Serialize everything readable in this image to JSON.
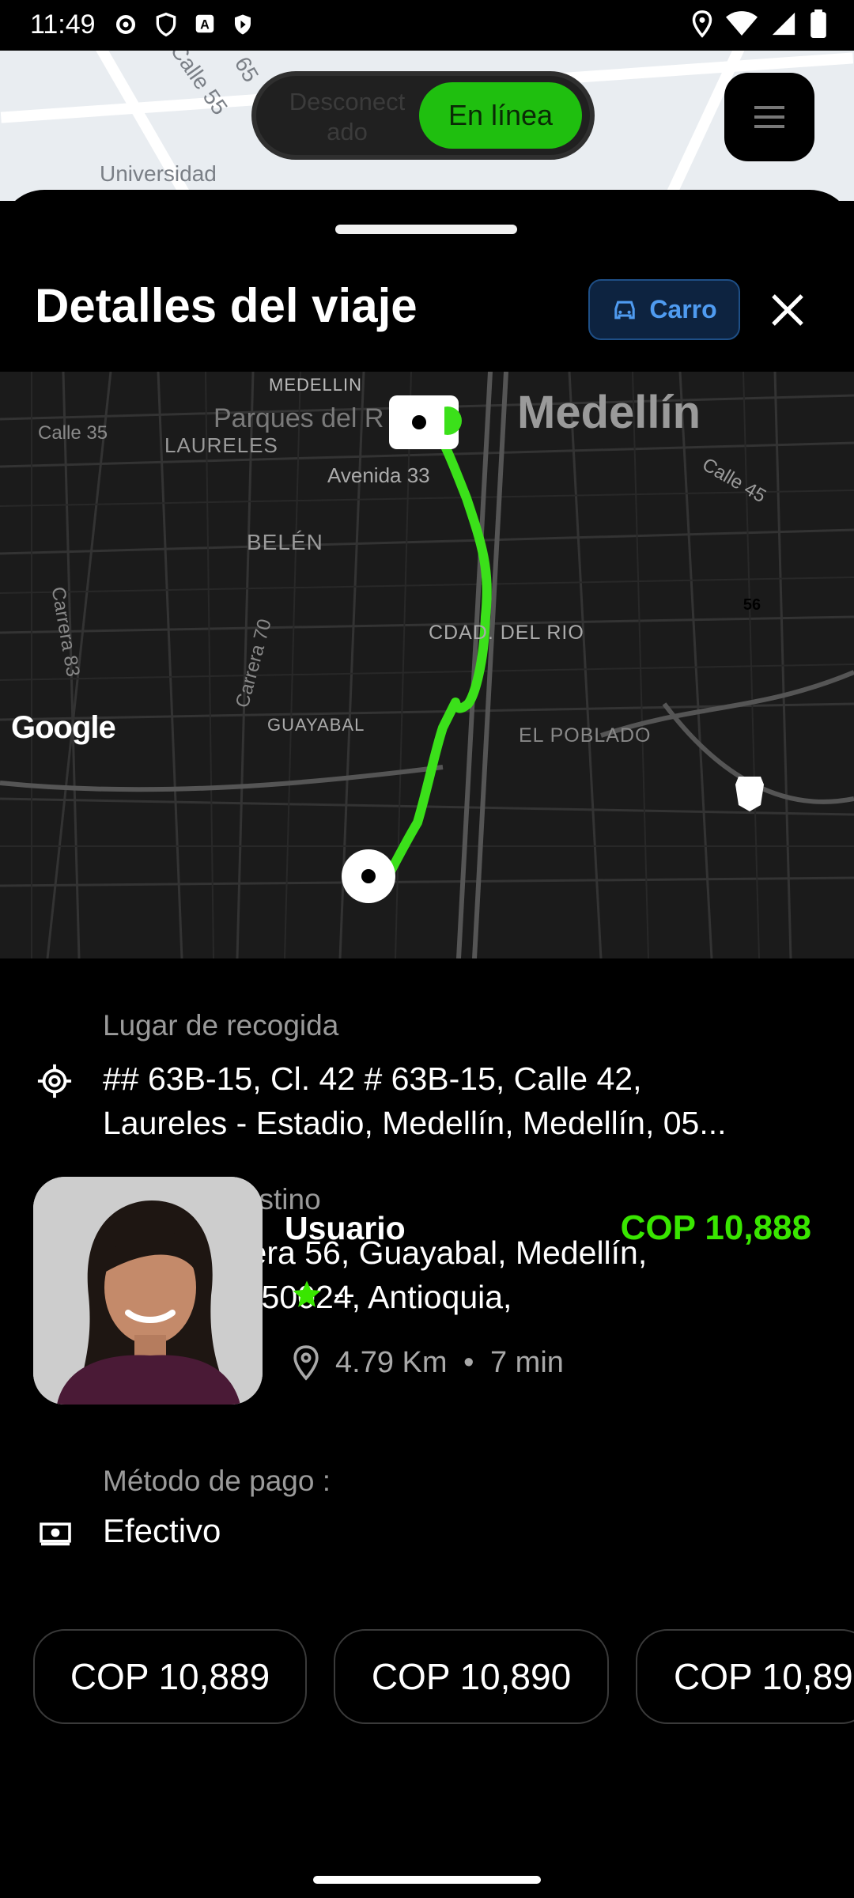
{
  "status_bar": {
    "time": "11:49"
  },
  "top_map": {
    "street_label_1": "Calle 55",
    "street_label_2": "Universidad",
    "street_label_3": "65"
  },
  "toggle": {
    "offline_label": "Desconectado",
    "online_label": "En línea"
  },
  "sheet": {
    "title": "Detalles del viaje",
    "vehicle_badge": "Carro",
    "vehicle_icon": "car-icon"
  },
  "map": {
    "labels": {
      "medellin_small": "MEDELLIN",
      "medellin_big": "Medellín",
      "parques": "Parques del R",
      "laureles": "LAURELES",
      "calle35": "Calle 35",
      "avenida33": "Avenida 33",
      "calle45": "Calle 45",
      "belen": "BELÉN",
      "carrera83": "Carrera 83",
      "carrera70": "Carrera 70",
      "cdad_rio": "CDAD. DEL RIO",
      "guayabal": "GUAYABAL",
      "poblado": "EL POBLADO",
      "route56": "56"
    },
    "attribution": "Google",
    "route_color": "#3be01a"
  },
  "pickup": {
    "label": "Lugar de recogida",
    "address_line1": "## 63B-15, Cl. 42 # 63B-15, Calle 42,",
    "address_line2": "Laureles - Estadio, Medellín, Medellín, 05..."
  },
  "destination": {
    "label": "Lugar de destino",
    "address_line1": "5-50, Carrera 56, Guayabal, Medellín,",
    "address_line2": "Medellín, 050024, Antioquia,"
  },
  "user": {
    "name": "Usuario",
    "price": "COP 10,888",
    "rating": "--",
    "distance": "4.79 Km",
    "separator": "•",
    "duration": "7 min"
  },
  "payment": {
    "label": "Método de pago :",
    "value": "Efectivo"
  },
  "offers": [
    "COP 10,889",
    "COP 10,890",
    "COP 10,89"
  ],
  "colors": {
    "accent_green": "#39e600",
    "badge_blue": "#4f9bf0"
  }
}
